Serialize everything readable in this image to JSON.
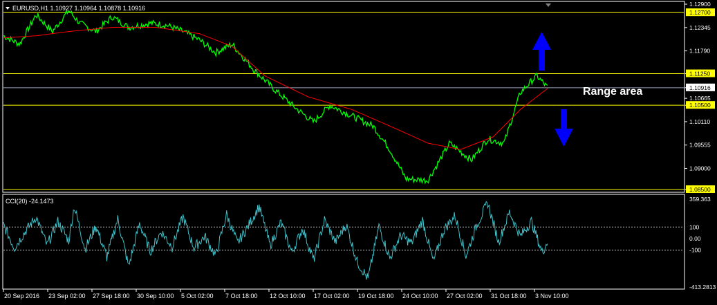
{
  "window": {
    "header_text": "EURUSD,H1  1.10927 1.10964 1.10878 1.10916",
    "menu_icon": "triangle-down-icon",
    "shift_marker_icon": "triangle-down-icon"
  },
  "colors": {
    "background": "#000000",
    "price_line": "#00ff00",
    "moving_average": "#ff0000",
    "level_lines": "#ffff00",
    "current_price_line": "#9aa3c0",
    "cci_line": "#40c0c8",
    "arrows": "#0000ff",
    "axis_text": "#ffffff"
  },
  "price_panel": {
    "y_ticks": [
      "1.12900",
      "1.12345",
      "1.11790",
      "1.11250",
      "1.10916",
      "1.10665",
      "1.10500",
      "1.10110",
      "1.09555",
      "1.09000",
      "1.08500"
    ],
    "highlighted_levels": [
      "1.12700",
      "1.11250",
      "1.10500",
      "1.08500"
    ],
    "current_price": "1.10916",
    "annotation": "Range area",
    "arrow_up_icon": "arrow-up-icon",
    "arrow_down_icon": "arrow-down-icon"
  },
  "indicator_panel": {
    "header_text": "CCI(20) -24.1473",
    "y_ticks": [
      "359.363",
      "100",
      "0.00",
      "-100",
      "-413.2813"
    ]
  },
  "x_axis": {
    "labels": [
      "20 Sep 2016",
      "23 Sep 02:00",
      "27 Sep 18:00",
      "30 Sep 10:00",
      "5 Oct 02:00",
      "7 Oct 18:00",
      "12 Oct 10:00",
      "17 Oct 02:00",
      "19 Oct 18:00",
      "24 Oct 10:00",
      "27 Oct 02:00",
      "31 Oct 18:00",
      "3 Nov 10:00"
    ]
  },
  "chart_data": [
    {
      "type": "line",
      "title": "EURUSD,H1",
      "ylim": [
        1.085,
        1.129
      ],
      "levels": [
        1.127,
        1.1125,
        1.105,
        1.085
      ],
      "current_price": 1.10916,
      "series": [
        {
          "name": "",
          "x": [
            0,
            3,
            6,
            9,
            12,
            14,
            17,
            20,
            23,
            27,
            30,
            33,
            36,
            39,
            42,
            46,
            50,
            54,
            57,
            60,
            64,
            68,
            71,
            74,
            78,
            82,
            86,
            89,
            92,
            95,
            98,
            100
          ],
          "values": [
            1.1215,
            1.1195,
            1.1265,
            1.1225,
            1.1275,
            1.1245,
            1.1225,
            1.126,
            1.1235,
            1.1245,
            1.124,
            1.1225,
            1.1205,
            1.1175,
            1.1195,
            1.1135,
            1.1085,
            1.104,
            1.101,
            1.105,
            1.1025,
            1.1,
            1.0945,
            1.0875,
            1.0872,
            1.096,
            1.092,
            1.097,
            1.096,
            1.108,
            1.112,
            1.1092
          ]
        },
        {
          "name": "",
          "x": [
            0,
            6,
            12,
            20,
            28,
            36,
            42,
            48,
            56,
            64,
            72,
            78,
            84,
            90,
            95,
            100
          ],
          "values": [
            1.121,
            1.1215,
            1.1225,
            1.1235,
            1.1235,
            1.122,
            1.119,
            1.112,
            1.107,
            1.104,
            1.0995,
            1.096,
            1.0945,
            1.0975,
            1.104,
            1.109
          ]
        }
      ]
    },
    {
      "type": "line",
      "title": "CCI(20) -24.1473",
      "ylim": [
        -413.2813,
        359.363
      ],
      "levels": [
        100,
        0,
        -100
      ],
      "series": [
        {
          "name": "",
          "x": [
            0,
            2,
            4,
            6,
            8,
            10,
            12,
            13,
            15,
            17,
            19,
            21,
            23,
            25,
            27,
            29,
            31,
            33,
            35,
            37,
            39,
            41,
            43,
            45,
            47,
            49,
            51,
            53,
            55,
            57,
            59,
            61,
            63,
            65,
            67,
            69,
            71,
            73,
            75,
            77,
            79,
            81,
            83,
            85,
            87,
            89,
            91,
            93,
            95,
            97,
            99,
            100
          ],
          "values": [
            120,
            -80,
            60,
            190,
            -60,
            150,
            -20,
            280,
            -90,
            110,
            -160,
            170,
            -240,
            130,
            -110,
            60,
            -70,
            190,
            -80,
            20,
            -150,
            210,
            -40,
            110,
            280,
            -60,
            140,
            -120,
            90,
            -190,
            160,
            -30,
            120,
            -200,
            -350,
            110,
            -170,
            30,
            -40,
            160,
            -200,
            80,
            200,
            -150,
            120,
            310,
            -30,
            230,
            20,
            150,
            -120,
            -24.1473
          ]
        }
      ]
    }
  ]
}
